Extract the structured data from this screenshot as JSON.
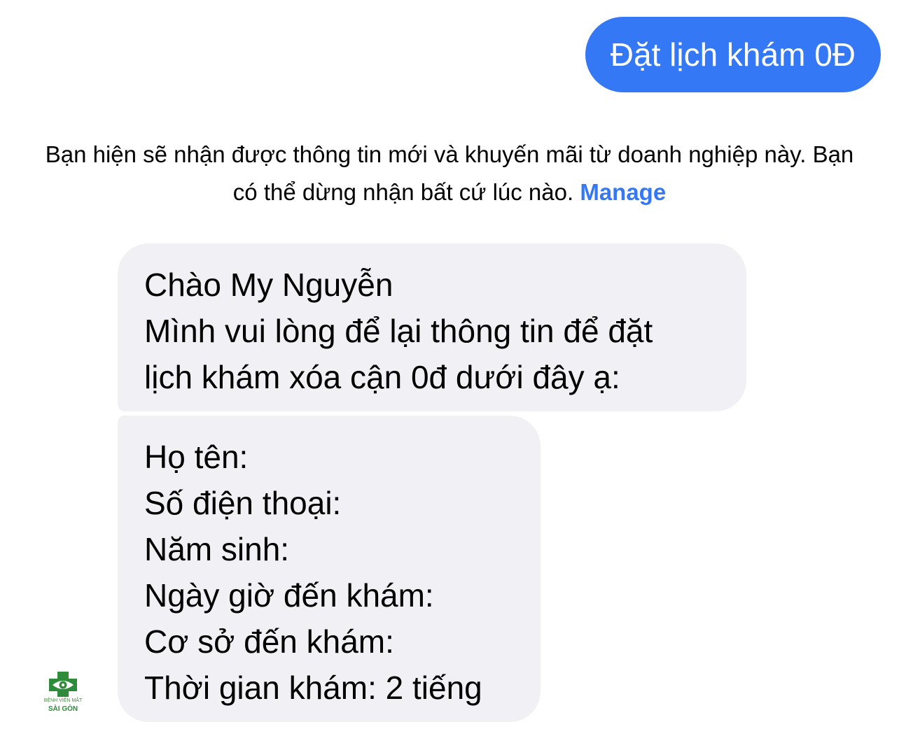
{
  "sent_message": {
    "text": "Đặt lịch khám 0Đ"
  },
  "notice": {
    "text": "Bạn hiện sẽ nhận được thông tin mới và khuyến mãi từ doanh nghiệp này. Bạn có thể dừng nhận bất cứ lúc nào.",
    "manage_link": "Manage"
  },
  "received_messages": [
    {
      "lines": [
        "Chào My Nguyễn",
        "Mình vui lòng để lại thông tin để đặt",
        "lịch khám xóa cận 0đ dưới đây ạ:"
      ]
    },
    {
      "lines": [
        "Họ tên:",
        "Số điện thoại:",
        "Năm sinh:",
        "Ngày giờ đến khám:",
        "Cơ sở đến khám:",
        "Thời gian khám: 2 tiếng"
      ]
    }
  ],
  "sender_avatar": {
    "hospital_name": "BỆNH VIỆN MẮT",
    "hospital_city": "SÀI GÒN",
    "brand_color": "#2e8b3a"
  },
  "colors": {
    "accent": "#3478f6",
    "received_bubble": "#f1f1f5"
  }
}
